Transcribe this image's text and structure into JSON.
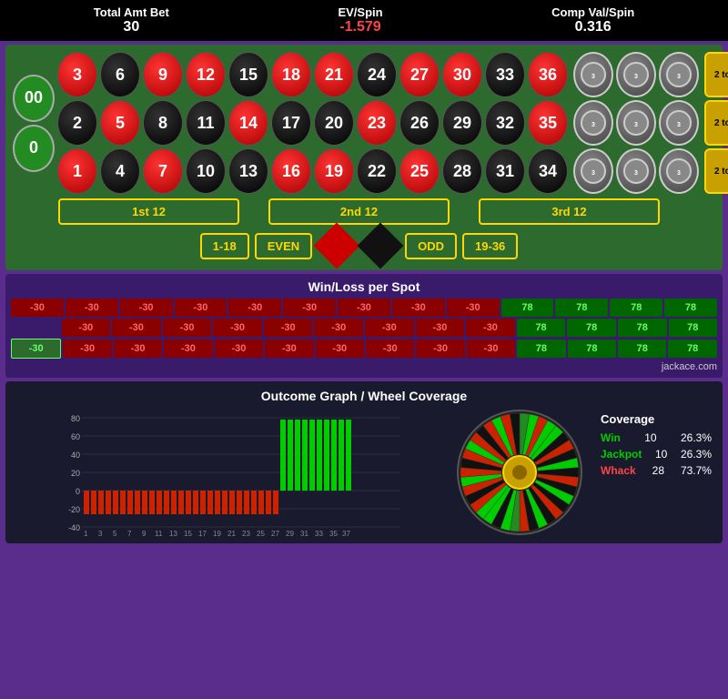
{
  "stats": {
    "total_label": "Total Amt Bet",
    "total_value": "30",
    "ev_label": "EV/Spin",
    "ev_value": "-1.579",
    "comp_label": "Comp Val/Spin",
    "comp_value": "0.316"
  },
  "table": {
    "zeros": [
      "00",
      "0"
    ],
    "rows": [
      [
        3,
        6,
        9,
        12,
        15,
        18,
        21,
        24
      ],
      [
        2,
        5,
        8,
        11,
        14,
        17,
        20,
        23
      ],
      [
        1,
        4,
        7,
        10,
        13,
        16,
        19,
        22
      ]
    ],
    "col3_rows": [
      [
        27,
        30,
        33,
        36
      ],
      [
        26,
        29,
        32,
        35
      ],
      [
        25,
        28,
        31,
        34
      ]
    ],
    "number_colors": {
      "red": [
        1,
        3,
        5,
        7,
        9,
        12,
        14,
        16,
        18,
        19,
        21,
        23,
        25,
        27,
        30,
        32,
        34,
        36
      ],
      "black": [
        2,
        4,
        6,
        8,
        10,
        11,
        13,
        15,
        17,
        20,
        22,
        24,
        26,
        28,
        29,
        31,
        33,
        35
      ]
    },
    "dozen_bets": [
      "1st 12",
      "2nd 12",
      "3rd 12"
    ],
    "bottom_bets": [
      "1-18",
      "EVEN",
      "ODD",
      "19-36"
    ]
  },
  "winloss": {
    "title": "Win/Loss per Spot",
    "rows": [
      [
        "-30",
        "-30",
        "-30",
        "-30",
        "-30",
        "-30",
        "-30",
        "-30",
        "-30",
        "78",
        "78",
        "78",
        "78"
      ],
      [
        "",
        "-30",
        "-30",
        "-30",
        "-30",
        "-30",
        "-30",
        "-30",
        "-30",
        "-30",
        "78",
        "78",
        "78",
        "78"
      ],
      [
        "-30",
        "-30",
        "-30",
        "-30",
        "-30",
        "-30",
        "-30",
        "-30",
        "-30",
        "-30",
        "78",
        "78",
        "78",
        "78"
      ]
    ],
    "bet_cells": [
      "-30",
      "",
      "-30"
    ],
    "watermark": "jackace.com"
  },
  "outcome": {
    "title": "Outcome Graph / Wheel Coverage",
    "y_labels": [
      "80",
      "60",
      "40",
      "20",
      "0",
      "-20",
      "-40"
    ],
    "x_labels": [
      "1",
      "3",
      "5",
      "7",
      "9",
      "11",
      "13",
      "15",
      "17",
      "19",
      "21",
      "23",
      "25",
      "27",
      "29",
      "31",
      "33",
      "35",
      "37"
    ],
    "bars": {
      "red_count": 25,
      "green_count": 10
    },
    "coverage": {
      "title": "Coverage",
      "win_label": "Win",
      "win_count": "10",
      "win_pct": "26.3%",
      "jackpot_label": "Jackpot",
      "jackpot_count": "10",
      "jackpot_pct": "26.3%",
      "whack_label": "Whack",
      "whack_count": "28",
      "whack_pct": "73.7%"
    }
  }
}
